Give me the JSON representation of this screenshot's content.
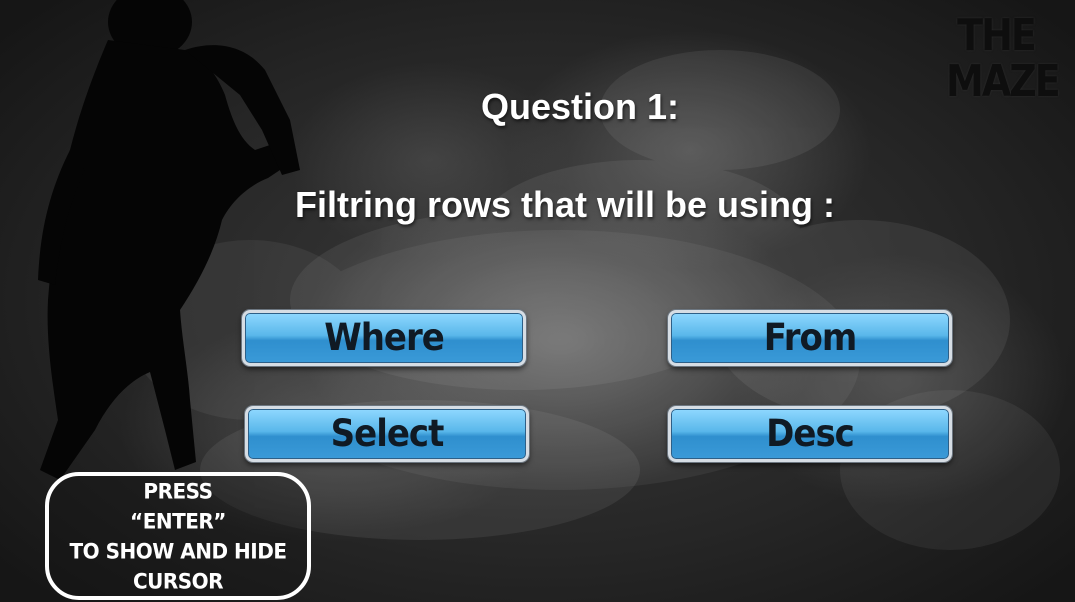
{
  "logo": {
    "line1": "THE",
    "line2": "MAZE"
  },
  "question": {
    "title": "Question 1:",
    "text": "Filtring rows that will be using :"
  },
  "answers": [
    {
      "label": "Where"
    },
    {
      "label": "From"
    },
    {
      "label": "Select"
    },
    {
      "label": "Desc"
    }
  ],
  "hint": {
    "line1": "PRESS",
    "line2": "“ENTER”",
    "line3": "TO SHOW AND HIDE",
    "line4": "CURSOR"
  },
  "colors": {
    "button_top": "#8fd8ff",
    "button_bottom": "#2f8fce",
    "text": "#ffffff",
    "silhouette": "#050505"
  }
}
